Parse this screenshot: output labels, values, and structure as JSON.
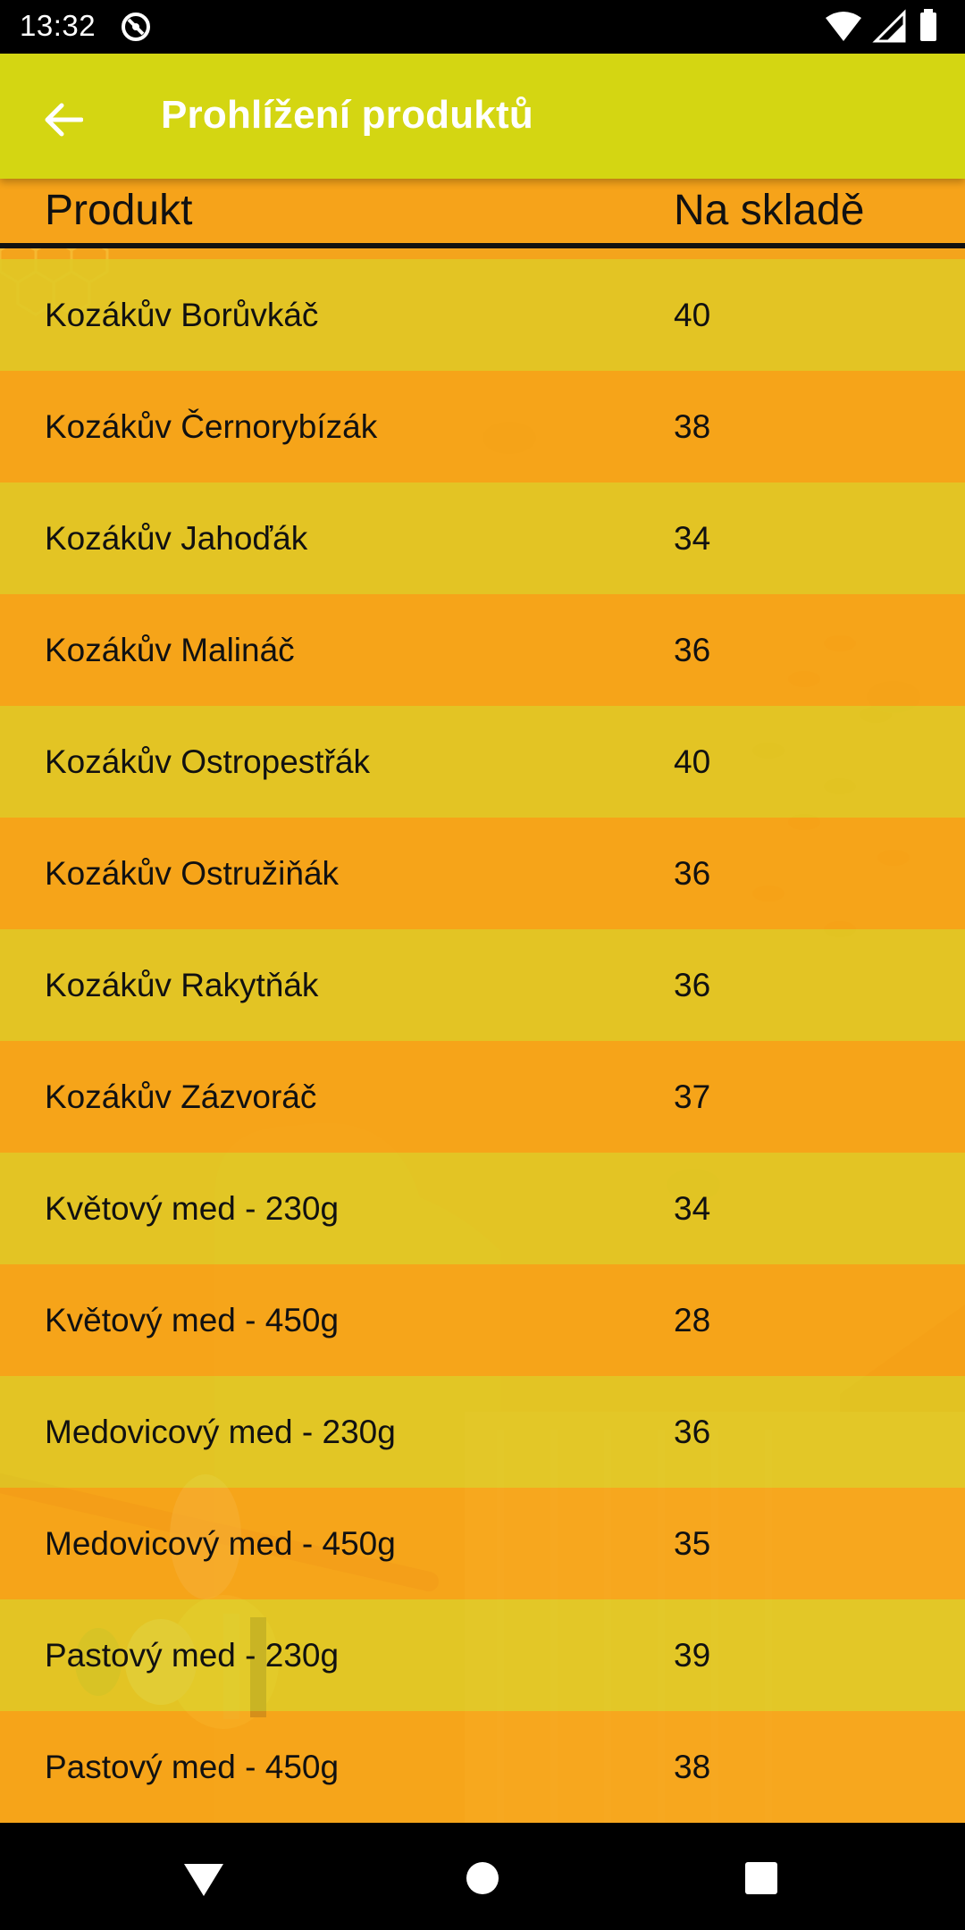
{
  "status_bar": {
    "time": "13:32"
  },
  "app_bar": {
    "title": "Prohlížení produktů",
    "back_icon": "arrow-left-icon"
  },
  "table": {
    "headers": {
      "product": "Produkt",
      "stock": "Na skladě"
    },
    "rows": [
      {
        "name": "Kozákův Borůvkáč",
        "qty": "40"
      },
      {
        "name": "Kozákův Černorybízák",
        "qty": "38"
      },
      {
        "name": "Kozákův Jahoďák",
        "qty": "34"
      },
      {
        "name": "Kozákův Malináč",
        "qty": "36"
      },
      {
        "name": "Kozákův Ostropestřák",
        "qty": "40"
      },
      {
        "name": "Kozákův Ostružiňák",
        "qty": "36"
      },
      {
        "name": "Kozákův Rakytňák",
        "qty": "36"
      },
      {
        "name": "Kozákův Zázvoráč",
        "qty": "37"
      },
      {
        "name": "Květový med - 230g",
        "qty": "34"
      },
      {
        "name": "Květový med - 450g",
        "qty": "28"
      },
      {
        "name": "Medovicový med - 230g",
        "qty": "36"
      },
      {
        "name": "Medovicový med - 450g",
        "qty": "35"
      },
      {
        "name": "Pastový med - 230g",
        "qty": "39"
      },
      {
        "name": "Pastový med - 450g",
        "qty": "38"
      }
    ]
  },
  "colors": {
    "app_bar": "#d4d612",
    "header": "#f6a31a",
    "row_odd": "#e0ca25",
    "row_even": "#f7a318"
  },
  "nav": {
    "back_icon": "triangle-back-icon",
    "home_icon": "circle-home-icon",
    "recents_icon": "square-recents-icon"
  }
}
